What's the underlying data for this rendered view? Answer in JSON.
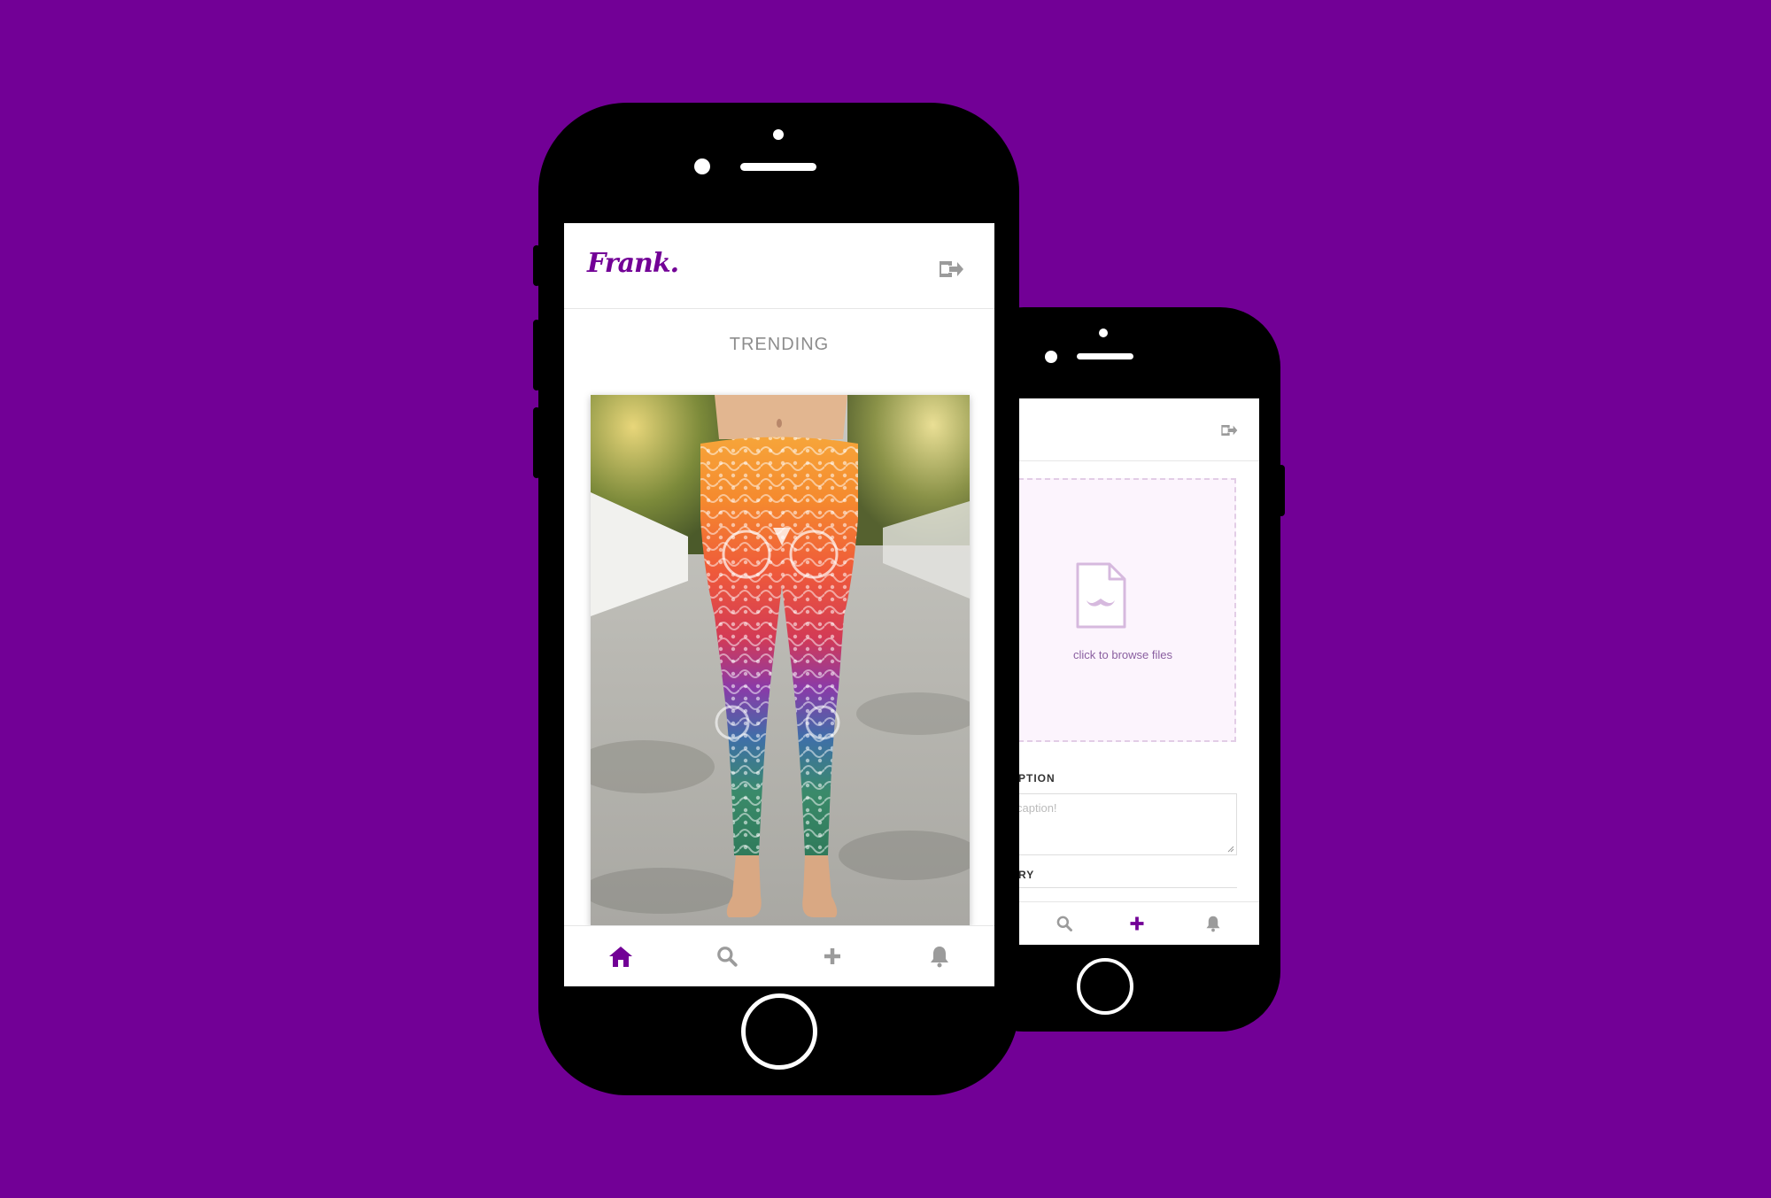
{
  "colors": {
    "background": "#720096",
    "accent": "#720096",
    "inactive_icon": "#9b9b9b",
    "dropzone_bg": "#fcf4fd"
  },
  "front_phone": {
    "header": {
      "logo": "Frank.",
      "logout_icon": "logout-icon"
    },
    "section_title": "TRENDING",
    "post": {
      "image": "photo of legs wearing colorful mandala-print leggings"
    },
    "tabbar": [
      {
        "icon": "home-icon",
        "active": true
      },
      {
        "icon": "search-icon",
        "active": false
      },
      {
        "icon": "plus-icon",
        "active": false
      },
      {
        "icon": "bell-icon",
        "active": false
      }
    ]
  },
  "back_phone": {
    "header": {
      "logout_icon": "logout-icon"
    },
    "upload": {
      "icon": "file-mustache-icon",
      "text": "click to browse files"
    },
    "caption_label": "PTION",
    "caption_placeholder": "caption!",
    "category_label": "RY",
    "tabbar": [
      {
        "icon": "search-icon",
        "active": false
      },
      {
        "icon": "plus-icon",
        "active": true
      },
      {
        "icon": "bell-icon",
        "active": false
      }
    ]
  }
}
